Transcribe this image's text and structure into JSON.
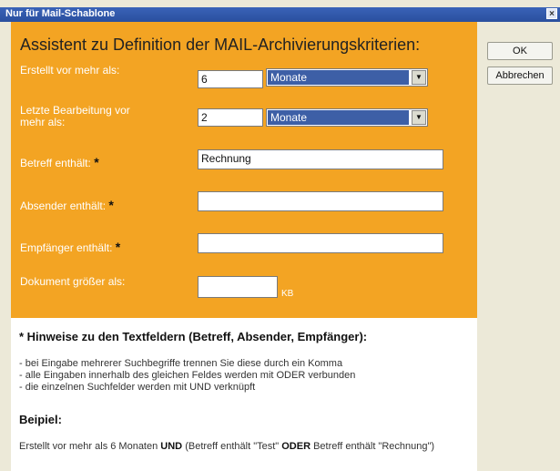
{
  "window": {
    "title": "Nur für Mail-Schablone",
    "close_glyph": "×"
  },
  "form": {
    "heading": "Assistent zu Definition der MAIL-Archivierungskriterien:",
    "created": {
      "label": "Erstellt vor mehr als:",
      "value": "6",
      "unit": "Monate"
    },
    "edited": {
      "label": "Letzte Bearbeitung vor mehr als:",
      "value": "2",
      "unit": "Monate"
    },
    "subject": {
      "label": "Betreff enthält:",
      "value": "Rechnung"
    },
    "sender": {
      "label": "Absender enthält:",
      "value": ""
    },
    "recipient": {
      "label": "Empfänger enthält:",
      "value": ""
    },
    "size": {
      "label": "Dokument größer als:",
      "value": "",
      "unit": "KB"
    },
    "required_marker": "*"
  },
  "buttons": {
    "ok": "OK",
    "cancel": "Abbrechen"
  },
  "notes": {
    "heading": "* Hinweise zu den Textfeldern (Betreff, Absender, Empfänger):",
    "bullets": [
      "- bei Eingabe mehrerer Suchbegriffe trennen Sie diese durch ein Komma",
      "- alle Eingaben innerhalb des gleichen Feldes werden mit ODER verbunden",
      "- die einzelnen Suchfelder werden mit UND verknüpft"
    ],
    "example_heading": "Beipiel:",
    "example": {
      "part1": "Erstellt vor mehr als 6 Monaten ",
      "and": "UND",
      "part2": " (Betreff enthält \"Test\" ",
      "or": "ODER",
      "part3": " Betreff enthält \"Rechnung\")"
    }
  },
  "colors": {
    "panel": "#f3a423",
    "title_bar": "#2a4f9e",
    "selection": "#3d5fa6"
  },
  "icons": {
    "close": "close-icon",
    "dropdown": "chevron-down-icon"
  }
}
